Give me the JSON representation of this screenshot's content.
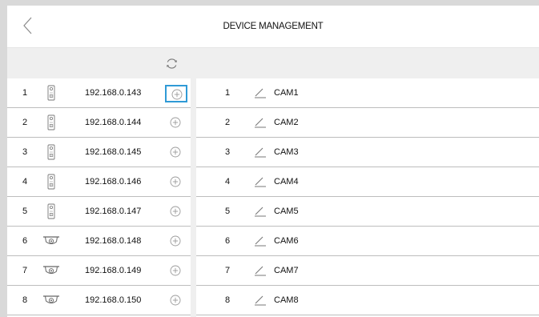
{
  "header": {
    "title": "DEVICE MANAGEMENT"
  },
  "icons": {
    "back": "chevron-left-icon",
    "refresh": "refresh-icon",
    "add": "add-circle-icon",
    "edit": "pencil-icon"
  },
  "colors": {
    "selection": "#2f9ad6"
  },
  "devices": [
    {
      "index": "1",
      "ip": "192.168.0.143",
      "type": "outdoor-station-icon",
      "selected": true
    },
    {
      "index": "2",
      "ip": "192.168.0.144",
      "type": "outdoor-station-icon",
      "selected": false
    },
    {
      "index": "3",
      "ip": "192.168.0.145",
      "type": "outdoor-station-icon",
      "selected": false
    },
    {
      "index": "4",
      "ip": "192.168.0.146",
      "type": "outdoor-station-icon",
      "selected": false
    },
    {
      "index": "5",
      "ip": "192.168.0.147",
      "type": "outdoor-station-icon",
      "selected": false
    },
    {
      "index": "6",
      "ip": "192.168.0.148",
      "type": "dome-camera-icon",
      "selected": false
    },
    {
      "index": "7",
      "ip": "192.168.0.149",
      "type": "dome-camera-icon",
      "selected": false
    },
    {
      "index": "8",
      "ip": "192.168.0.150",
      "type": "dome-camera-icon",
      "selected": false
    }
  ],
  "cameras": [
    {
      "index": "1",
      "name": "CAM1"
    },
    {
      "index": "2",
      "name": "CAM2"
    },
    {
      "index": "3",
      "name": "CAM3"
    },
    {
      "index": "4",
      "name": "CAM4"
    },
    {
      "index": "5",
      "name": "CAM5"
    },
    {
      "index": "6",
      "name": "CAM6"
    },
    {
      "index": "7",
      "name": "CAM7"
    },
    {
      "index": "8",
      "name": "CAM8"
    }
  ]
}
